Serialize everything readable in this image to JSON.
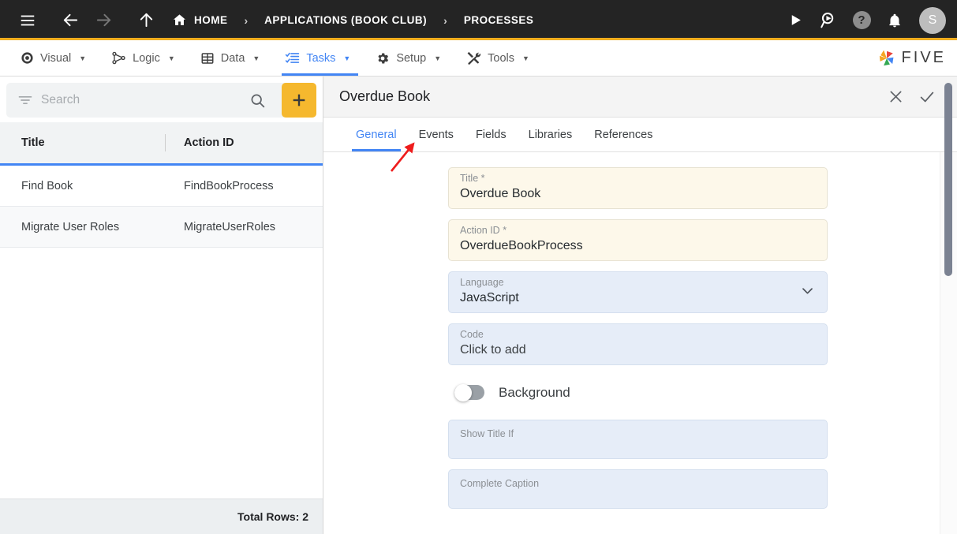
{
  "topbar": {
    "menu_icon": "hamburger-menu-icon",
    "back_icon": "arrow-back-icon",
    "forward_icon": "arrow-forward-icon",
    "up_icon": "arrow-up-icon",
    "home_icon": "home-icon",
    "breadcrumbs": [
      {
        "label": "HOME"
      },
      {
        "label": "APPLICATIONS (BOOK CLUB)"
      },
      {
        "label": "PROCESSES"
      }
    ],
    "separator": "›",
    "actions": [
      {
        "name": "run-icon",
        "label": "Run"
      },
      {
        "name": "search-run-icon",
        "label": "Search and Run"
      },
      {
        "name": "help-icon",
        "label": "?"
      },
      {
        "name": "notifications-bell-icon",
        "label": "Notifications"
      }
    ],
    "avatar_initial": "S",
    "accent_bar_color": "#f0ad1e",
    "background_color": "#242424"
  },
  "menubar": {
    "items": [
      {
        "label": "Visual",
        "icon": "eye-icon",
        "active": false
      },
      {
        "label": "Logic",
        "icon": "nodes-graph-icon",
        "active": false
      },
      {
        "label": "Data",
        "icon": "table-grid-icon",
        "active": false
      },
      {
        "label": "Tasks",
        "icon": "checklist-icon",
        "active": true
      },
      {
        "label": "Setup",
        "icon": "gear-icon",
        "active": false
      },
      {
        "label": "Tools",
        "icon": "tools-wrench-icon",
        "active": false
      }
    ],
    "caret": "▼",
    "brand_text": "FIVE",
    "brand_icon": "five-pinwheel-logo",
    "active_color": "#4285f4"
  },
  "left_panel": {
    "search": {
      "placeholder": "Search",
      "value": "",
      "filter_icon": "filter-icon",
      "search_icon": "search-icon"
    },
    "add_button": {
      "label": "+",
      "icon": "plus-icon",
      "color": "#f5b82e"
    },
    "table": {
      "columns": [
        "Title",
        "Action ID"
      ],
      "rows": [
        {
          "title": "Find Book",
          "action_id": "FindBookProcess"
        },
        {
          "title": "Migrate User Roles",
          "action_id": "MigrateUserRoles"
        }
      ]
    },
    "footer": {
      "total_rows_label": "Total Rows: 2"
    }
  },
  "detail_panel": {
    "title": "Overdue Book",
    "close_icon": "close-icon",
    "confirm_icon": "check-icon",
    "tabs": [
      {
        "label": "General",
        "active": true
      },
      {
        "label": "Events",
        "active": false
      },
      {
        "label": "Fields",
        "active": false
      },
      {
        "label": "Libraries",
        "active": false
      },
      {
        "label": "References",
        "active": false
      }
    ],
    "fields": [
      {
        "label": "Title",
        "required": true,
        "value": "Overdue Book",
        "type": "text"
      },
      {
        "label": "Action ID",
        "required": true,
        "value": "OverdueBookProcess",
        "type": "text"
      },
      {
        "label": "Language",
        "required": false,
        "value": "JavaScript",
        "type": "select"
      },
      {
        "label": "Code",
        "required": false,
        "value": "Click to add",
        "type": "link"
      },
      {
        "label": "Show Title If",
        "required": false,
        "value": "",
        "type": "text"
      },
      {
        "label": "Complete Caption",
        "required": false,
        "value": "",
        "type": "text"
      }
    ],
    "toggle": {
      "label": "Background",
      "on": false
    },
    "required_marker": "*",
    "dropdown_icon": "chevron-down-icon",
    "scrollbar": "vertical-scrollbar"
  },
  "annotation": {
    "arrow": "red-arrow-pointing-to-events-tab",
    "color": "#ee1c1c"
  }
}
